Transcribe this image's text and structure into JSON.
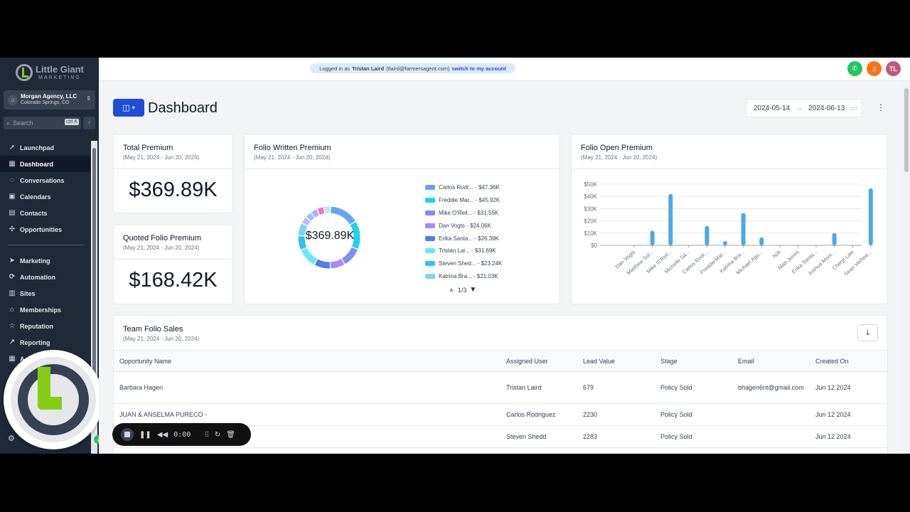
{
  "brand": {
    "name_line1": "Little Giant",
    "name_line2": "MARKETING",
    "accent": "#84cc16"
  },
  "account": {
    "name": "Morgan Agency, LLC",
    "location": "Colorado Springs, CO"
  },
  "search": {
    "placeholder": "Search",
    "shortcut": "ctrl K"
  },
  "nav": {
    "group1": [
      {
        "label": "Launchpad",
        "icon": "rocket-icon"
      },
      {
        "label": "Dashboard",
        "icon": "grid-icon",
        "active": true
      },
      {
        "label": "Conversations",
        "icon": "chat-icon"
      },
      {
        "label": "Calendars",
        "icon": "calendar-icon"
      },
      {
        "label": "Contacts",
        "icon": "contacts-icon"
      },
      {
        "label": "Opportunities",
        "icon": "opportunities-icon"
      }
    ],
    "group2": [
      {
        "label": "Marketing",
        "icon": "send-icon"
      },
      {
        "label": "Automation",
        "icon": "automation-icon"
      },
      {
        "label": "Sites",
        "icon": "sites-icon"
      },
      {
        "label": "Memberships",
        "icon": "graduation-icon"
      },
      {
        "label": "Reputation",
        "icon": "star-icon"
      },
      {
        "label": "Reporting",
        "icon": "chart-line-icon"
      },
      {
        "label": "A",
        "icon": "apps-icon"
      }
    ]
  },
  "topbar": {
    "logged_prefix": "Logged in as",
    "user_name": "Tristan Laird",
    "user_email": "(tlaird@farmersagent.com)",
    "switch_label": "switch to my account",
    "avatar_initials": "TL",
    "phone_color": "#22c55e",
    "bell_color": "#f97316",
    "avatar_color": "#c2577a"
  },
  "page": {
    "title": "Dashboard",
    "date_start": "2024-05-14",
    "date_end": "2024-06-13"
  },
  "cards": {
    "total_premium": {
      "title": "Total Premium",
      "range": "(May 21, 2024 - Jun 20, 2024)",
      "value": "$369.89K"
    },
    "quoted_premium": {
      "title": "Quoted Folio Premium",
      "range": "(May 21, 2024 - Jun 20, 2024)",
      "value": "$168.42K"
    },
    "written_premium": {
      "title": "Folio Written Premium",
      "range": "(May 21, 2024 - Jun 20, 2024)",
      "center": "$369.89K",
      "pager": "1/3"
    },
    "open_premium": {
      "title": "Folio Open Premium",
      "range": "(May 21, 2024 - Jun 20, 2024)"
    },
    "team_sales": {
      "title": "Team Folio Sales",
      "range": "(May 21, 2024 - Jun 20, 2024)"
    }
  },
  "chart_data": [
    {
      "type": "pie",
      "title": "Folio Written Premium",
      "center_label": "$369.89K",
      "labels": [
        "Carlos Rodr... - $47.36K",
        "Freddie Mar... - $45.92K",
        "Mike O'Reil... - $31.55K",
        "Dan Vogts - $24.06K",
        "Erika Santa... - $26.39K",
        "Tristan Lai... - $31.69K",
        "Steven Shed... - $23.24K",
        "Katrina Bra... - $21.03K"
      ],
      "values": [
        47.36,
        45.92,
        31.55,
        24.06,
        26.39,
        31.69,
        23.24,
        21.03
      ],
      "colors": [
        "#60a5fa",
        "#22d3ee",
        "#818cf8",
        "#a78bfa",
        "#4f7ee8",
        "#67e8f9",
        "#38bdf8",
        "#7dd3fc"
      ]
    },
    {
      "type": "bar",
      "title": "Folio Open Premium",
      "categories": [
        "Dan Vogts",
        "Matthew Sol...",
        "Mike O'Reil...",
        "Michelle Sa...",
        "Carlos Rodr...",
        "Freddie Mar...",
        "Katrina Bra...",
        "Michael Agu...",
        "N/A",
        "Matt Jones",
        "Erika Santa...",
        "Joshua Moor...",
        "Cheryl Law",
        "Sean Verhoe..."
      ],
      "values": [
        0,
        12,
        42,
        0,
        16,
        3.5,
        26.5,
        6.5,
        0,
        0,
        0,
        10,
        0,
        46.5
      ],
      "yticks": [
        "$0",
        "$10K",
        "$20K",
        "$30K",
        "$40K",
        "$50K"
      ],
      "ylim": [
        0,
        50
      ],
      "color": "#4aa8ec"
    }
  ],
  "table": {
    "columns": [
      "Opportunity Name",
      "Assigned User",
      "Lead Value",
      "Stage",
      "Email",
      "Created On"
    ],
    "rows": [
      {
        "name": "Barbara Hagen",
        "user": "Tristan Laird",
        "value": "679",
        "stage": "Policy Sold",
        "email": "bhagen6nt@gmail.com",
        "created": "Jun 12 2024"
      },
      {
        "name": "JUAN & ANSELMA PURECO -",
        "user": "Carlos Rodriguez",
        "value": "2230",
        "stage": "Policy Sold",
        "email": "",
        "created": "Jun 12 2024"
      },
      {
        "name": "",
        "user": "Steven Shedd",
        "value": "2283",
        "stage": "Policy Sold",
        "email": "",
        "created": "Jun 12 2024"
      }
    ]
  },
  "recorder": {
    "time": "0:00"
  }
}
